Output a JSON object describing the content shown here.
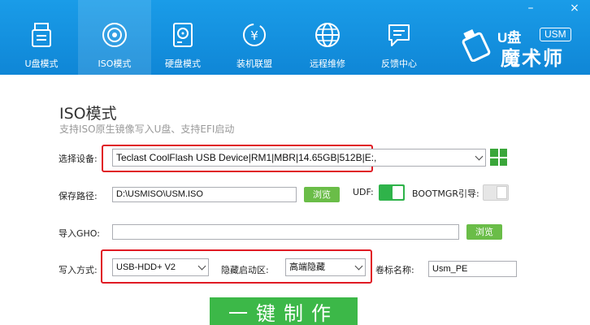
{
  "window": {
    "minimize": "–",
    "close": "×"
  },
  "nav": {
    "tabs": [
      {
        "label": "U盘模式"
      },
      {
        "label": "ISO模式"
      },
      {
        "label": "硬盘模式"
      },
      {
        "label": "装机联盟"
      },
      {
        "label": "远程维修"
      },
      {
        "label": "反馈中心"
      }
    ],
    "active": "ISO模式"
  },
  "logo": {
    "u_text": "U盘",
    "badge": "USM",
    "name": "魔术师"
  },
  "page": {
    "title": "ISO模式",
    "subtitle": "支持ISO原生镜像写入U盘、支持EFI启动"
  },
  "form": {
    "device_label": "选择设备:",
    "device_value": "Teclast CoolFlash USB Device|RM1|MBR|14.65GB|512B|E:,",
    "save_path_label": "保存路径:",
    "save_path_value": "D:\\USMISO\\USM.ISO",
    "browse_label": "浏览",
    "udf_label": "UDF:",
    "udf_on": true,
    "bootmgr_label": "BOOTMGR引导:",
    "bootmgr_on": false,
    "ghost_label": "导入GHO:",
    "ghost_value": "",
    "ghost_browse_label": "浏览",
    "write_mode_label": "写入方式:",
    "write_mode_value": "USB-HDD+ V2",
    "hidden_label": "隐藏启动区:",
    "hidden_value": "高端隐藏",
    "volume_label": "卷标名称:",
    "volume_value": "Usm_PE"
  },
  "action": {
    "make_label": "一键制作"
  },
  "colors": {
    "header": "#1592df",
    "accent_green": "#6abd48",
    "highlight_red": "#e01b24"
  }
}
